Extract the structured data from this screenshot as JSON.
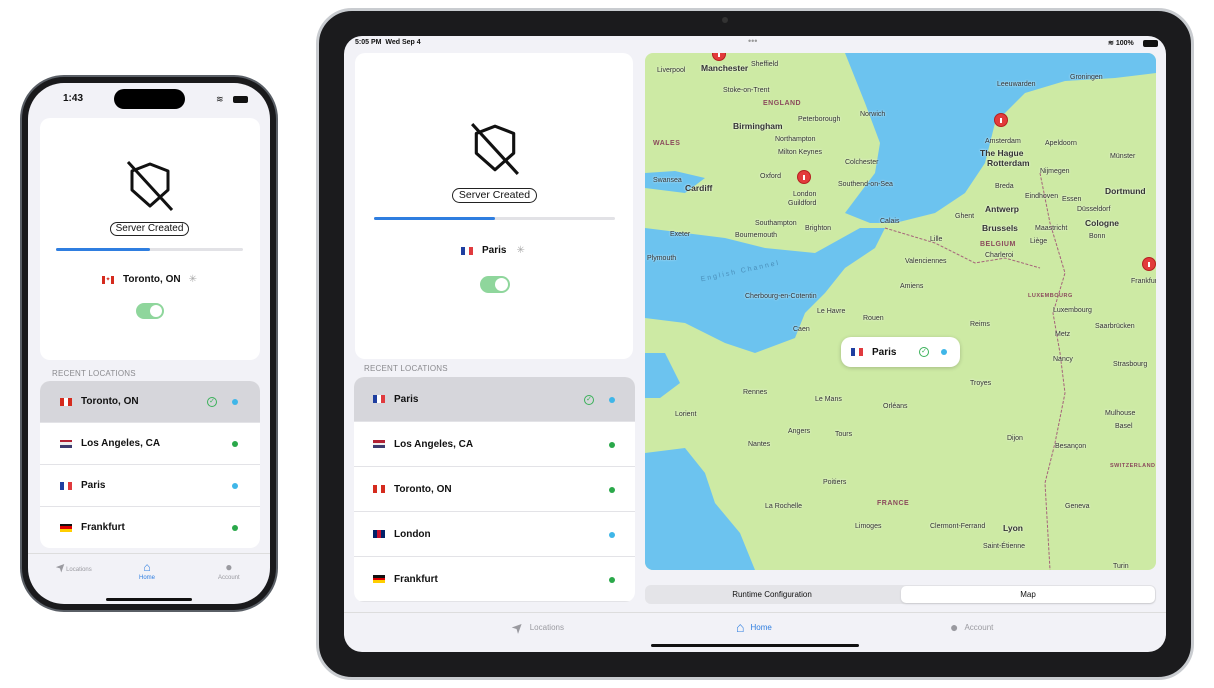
{
  "phone": {
    "status": {
      "time": "1:43"
    },
    "status_label": "Server Created",
    "progress": 0.5,
    "current_location": {
      "name": "Toronto, ON",
      "flag": "CA"
    },
    "vpn_toggle": true,
    "section_title": "RECENT LOCATIONS",
    "recent": [
      {
        "name": "Toronto, ON",
        "flag": "CA",
        "selected": true,
        "connected_check": true,
        "dot": "#3fb6e8"
      },
      {
        "name": "Los Angeles, CA",
        "flag": "US",
        "dot": "#2aa84a"
      },
      {
        "name": "Paris",
        "flag": "FR",
        "dot": "#3fb6e8"
      },
      {
        "name": "Frankfurt",
        "flag": "DE",
        "dot": "#2aa84a"
      }
    ],
    "tabs": [
      {
        "label": "Locations",
        "icon": "location-arrow-icon"
      },
      {
        "label": "Home",
        "icon": "house-icon",
        "active": true
      },
      {
        "label": "Account",
        "icon": "person-icon"
      }
    ]
  },
  "ipad": {
    "status": {
      "time": "5:05 PM",
      "date": "Wed Sep 4",
      "battery": "100%"
    },
    "status_label": "Server Created",
    "progress": 0.5,
    "current_location": {
      "name": "Paris",
      "flag": "FR"
    },
    "vpn_toggle": true,
    "section_title": "RECENT LOCATIONS",
    "recent": [
      {
        "name": "Paris",
        "flag": "FR",
        "selected": true,
        "connected_check": true,
        "dot": "#3fb6e8"
      },
      {
        "name": "Los Angeles, CA",
        "flag": "US",
        "dot": "#2aa84a"
      },
      {
        "name": "Toronto, ON",
        "flag": "CA",
        "dot": "#2aa84a"
      },
      {
        "name": "London",
        "flag": "GB",
        "dot": "#3fb6e8"
      },
      {
        "name": "Frankfurt",
        "flag": "DE",
        "dot": "#2aa84a"
      }
    ],
    "map": {
      "callout": {
        "name": "Paris",
        "flag": "FR"
      },
      "sea_label": "English Channel",
      "regions": [
        "ENGLAND",
        "WALES",
        "BELGIUM",
        "FRANCE",
        "LUXEMBOURG",
        "SWITZERLAND"
      ],
      "cities": [
        "Liverpool",
        "Manchester",
        "Sheffield",
        "Stoke-on-Trent",
        "Birmingham",
        "Peterborough",
        "Norwich",
        "Northampton",
        "Milton Keynes",
        "Colchester",
        "Oxford",
        "London",
        "Southend-on-Sea",
        "Swansea",
        "Cardiff",
        "Guildford",
        "Southampton",
        "Bournemouth",
        "Brighton",
        "Exeter",
        "Plymouth",
        "Leeuwarden",
        "Groningen",
        "Amsterdam",
        "Apeldoorn",
        "The Hague",
        "Rotterdam",
        "Nijmegen",
        "Münster",
        "Breda",
        "Eindhoven",
        "Essen",
        "Dortmund",
        "Antwerp",
        "Düsseldorf",
        "Ghent",
        "Calais",
        "Brussels",
        "Maastricht",
        "Cologne",
        "Lille",
        "Liège",
        "Bonn",
        "Charleroi",
        "Valenciennes",
        "Amiens",
        "Cherbourg-en-Cotentin",
        "Caen",
        "Le Havre",
        "Rouen",
        "Reims",
        "Metz",
        "Luxembourg",
        "Nancy",
        "Strasbourg",
        "Rennes",
        "Le Mans",
        "Orléans",
        "Troyes",
        "Tours",
        "Angers",
        "Nantes",
        "Lorient",
        "Dijon",
        "Besançon",
        "Mulhouse",
        "Basel",
        "Poitiers",
        "La Rochelle",
        "Limoges",
        "Clermont-Ferrand",
        "Lyon",
        "Geneva",
        "Saint-Étienne",
        "Turin",
        "Frankfurt",
        "Saarbrücken"
      ],
      "pins": [
        "Manchester",
        "London",
        "Amsterdam",
        "Frankfurt"
      ]
    },
    "segments": [
      {
        "label": "Runtime Configuration"
      },
      {
        "label": "Map",
        "active": true
      }
    ],
    "tabs": [
      {
        "label": "Locations",
        "icon": "location-arrow-icon"
      },
      {
        "label": "Home",
        "icon": "house-icon",
        "active": true
      },
      {
        "label": "Account",
        "icon": "person-icon"
      }
    ]
  },
  "colors": {
    "accent": "#2f7ee0",
    "toggle_on": "#8fd69c",
    "dot_blue": "#3fb6e8",
    "dot_green": "#2aa84a",
    "map_land": "#cdeaa4",
    "map_sea": "#6cc3ef"
  }
}
